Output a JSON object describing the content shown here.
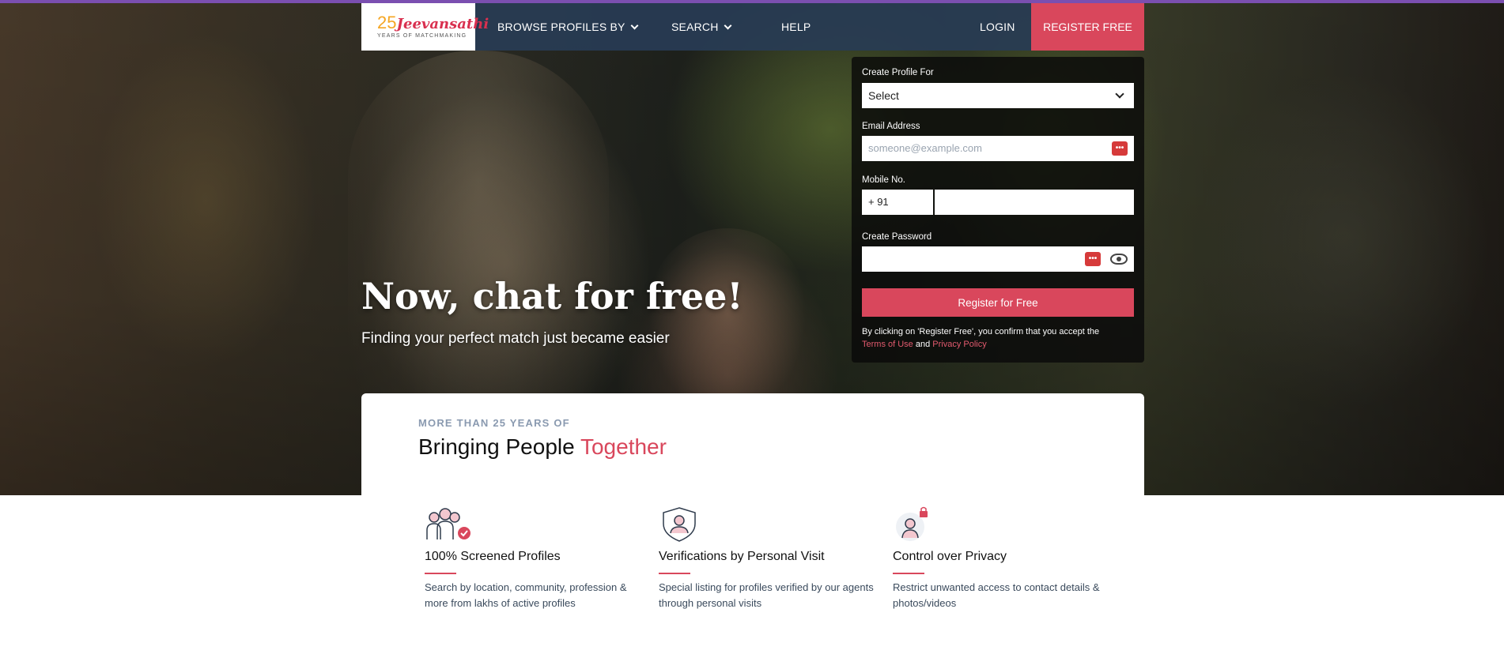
{
  "header": {
    "logo_number": "25",
    "logo_name": "Jeevansathi",
    "logo_tagline": "YEARS OF MATCHMAKING",
    "nav": [
      {
        "label": "BROWSE PROFILES BY"
      },
      {
        "label": "SEARCH"
      },
      {
        "label": "HELP"
      }
    ],
    "login_label": "LOGIN",
    "register_label": "REGISTER FREE"
  },
  "hero": {
    "headline": "Now, chat for free!",
    "subheadline": "Finding your perfect match just became easier"
  },
  "form": {
    "profile_for_label": "Create Profile For",
    "profile_for_value": "Select",
    "email_label": "Email Address",
    "email_placeholder": "someone@example.com",
    "mobile_label": "Mobile No.",
    "mobile_code": "+ 91",
    "mobile_value": "",
    "password_label": "Create Password",
    "password_value": "",
    "submit_label": "Register for Free",
    "consent_text": "By clicking on 'Register Free', you confirm that you accept the",
    "terms_label": "Terms of Use",
    "and_text": "and",
    "privacy_label": "Privacy Policy"
  },
  "intro": {
    "eyebrow": "MORE THAN 25 YEARS OF",
    "title_main": "Bringing People",
    "title_accent": "Together"
  },
  "features": [
    {
      "icon": "screened-profiles-icon",
      "title": "100% Screened Profiles",
      "description": "Search by location, community, profession & more from lakhs of active profiles"
    },
    {
      "icon": "verified-shield-icon",
      "title": "Verifications by Personal Visit",
      "description": "Special listing for profiles verified by our agents through personal visits"
    },
    {
      "icon": "privacy-lock-icon",
      "title": "Control over Privacy",
      "description": "Restrict unwanted access to contact details & photos/videos"
    }
  ],
  "colors": {
    "accent": "#d9475c",
    "navbar": "#283c55",
    "top_accent": "#7b4fb0"
  }
}
